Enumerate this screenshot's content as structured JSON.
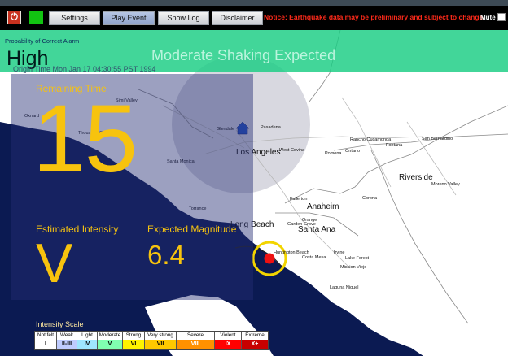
{
  "toolbar": {
    "buttons": [
      "Settings",
      "Play Event",
      "Show Log",
      "Disclaimer"
    ],
    "notice": "Notice: Earthquake data may be preliminary and subject to change",
    "mute_label": "Mute"
  },
  "alert": {
    "probability_label": "Probability of Correct Alarm",
    "level": "High",
    "shaking_text": "Moderate Shaking Expected",
    "origin_time": "Origin Time Mon Jan 17 04:30:55 PST 1994"
  },
  "panel": {
    "remaining_time_label": "Remaining Time",
    "remaining_seconds": "15",
    "intensity_label": "Estimated Intensity",
    "intensity_value": "V",
    "magnitude_label": "Expected Magnitude",
    "magnitude_value": "6.4"
  },
  "map": {
    "cities_large": [
      "Los Angeles",
      "Long Beach",
      "Anaheim",
      "Santa Ana",
      "Riverside"
    ],
    "cities_small": [
      "Simi Valley",
      "Oxnard",
      "Glendale",
      "Pasadena",
      "Rancho Cucamonga",
      "San Bernardino",
      "Ontario",
      "Fontana",
      "Pomona",
      "West Covina",
      "Santa Monica",
      "Torrance",
      "Fullerton",
      "Orange",
      "Garden Grove",
      "Huntington Beach",
      "Costa Mesa",
      "Irvine",
      "Lake Forest",
      "Mission Viejo",
      "Laguna Niguel",
      "Corona",
      "Moreno Valley",
      "Thousand Oaks"
    ]
  },
  "scale": {
    "title": "Intensity Scale",
    "cells": [
      {
        "top": "Not felt",
        "roman": "I",
        "color": "#ffffff"
      },
      {
        "top": "Weak",
        "roman": "II-III",
        "color": "#bfccff"
      },
      {
        "top": "Light",
        "roman": "IV",
        "color": "#9fe6ff"
      },
      {
        "top": "Moderate",
        "roman": "V",
        "color": "#80ffb0"
      },
      {
        "top": "Strong",
        "roman": "VI",
        "color": "#fff300"
      },
      {
        "top": "Very strong",
        "roman": "VII",
        "color": "#ffc800"
      },
      {
        "top": "Severe",
        "roman": "VIII",
        "color": "#ff9100"
      },
      {
        "top": "Violent",
        "roman": "IX",
        "color": "#ff0000"
      },
      {
        "top": "Extreme",
        "roman": "X+",
        "color": "#c80000"
      }
    ]
  }
}
